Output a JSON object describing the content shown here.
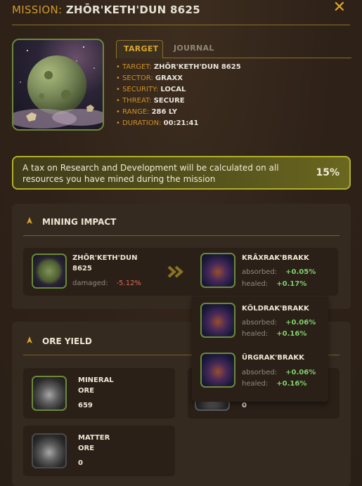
{
  "header": {
    "label": "MISSION:",
    "name": "ZHŌR'KETH'DUN 8625",
    "close_icon": "close-icon"
  },
  "tabs": [
    {
      "label": "TARGET",
      "active": true
    },
    {
      "label": "JOURNAL",
      "active": false
    }
  ],
  "info": [
    {
      "key": "TARGET:",
      "value": "ZHŌR'KETH'DUN 8625"
    },
    {
      "key": "SECTOR:",
      "value": "GRAXX"
    },
    {
      "key": "SECURITY:",
      "value": "LOCAL"
    },
    {
      "key": "THREAT:",
      "value": "SECURE"
    },
    {
      "key": "RANGE:",
      "value": "286 LY"
    },
    {
      "key": "DURATION:",
      "value": "00:21:41"
    }
  ],
  "tax": {
    "message": "A tax on Research and Development will be calculated on all resources you have mined during the mission",
    "percent": "15%"
  },
  "mining_impact": {
    "title": "MINING IMPACT",
    "target": {
      "name_line1": "ZHŌR'KETH'DUN",
      "name_line2": "8625",
      "damaged_label": "damaged:",
      "damaged_value": "-5.12%"
    },
    "arrow_icon": "double-chevron-right-icon",
    "entities": [
      {
        "name": "KRĀXRAK'BRAKK",
        "absorbed_label": "absorbed:",
        "absorbed": "+0.05%",
        "healed_label": "healed:",
        "healed": "+0.17%"
      },
      {
        "name": "KŌLDRAK'BRAKK",
        "absorbed_label": "absorbed:",
        "absorbed": "+0.06%",
        "healed_label": "healed:",
        "healed": "+0.16%"
      },
      {
        "name": "ŪRGRAK'BRAKK",
        "absorbed_label": "absorbed:",
        "absorbed": "+0.06%",
        "healed_label": "healed:",
        "healed": "+0.16%"
      }
    ]
  },
  "ore_yield": {
    "title": "ORE YIELD",
    "items": [
      {
        "line1": "MINERAL",
        "line2": "ORE",
        "amount": "659"
      },
      {
        "line1": "MATTER",
        "line2": "ORE",
        "amount": "0"
      },
      {
        "amount": "0"
      }
    ]
  },
  "colors": {
    "accent": "#d8a72a",
    "border_green": "#6b8a38",
    "positive": "#7fd06b",
    "negative": "#e06a5a",
    "tax_border": "#b3b02a"
  }
}
